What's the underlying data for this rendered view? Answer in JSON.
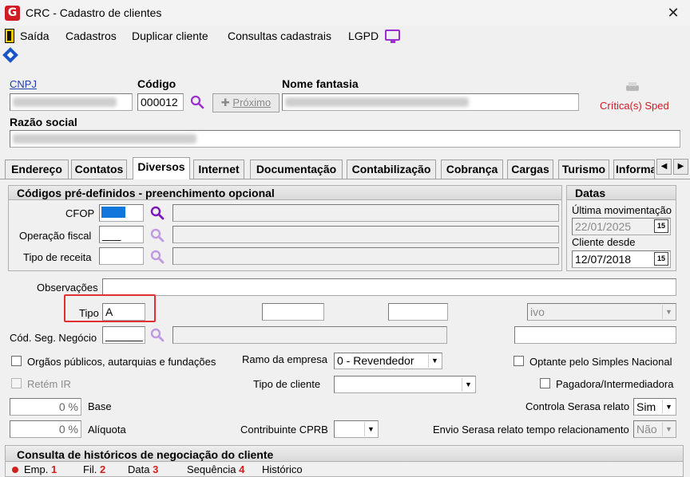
{
  "window": {
    "title": "CRC - Cadastro de clientes"
  },
  "menu": {
    "items": [
      "Saída",
      "Cadastros",
      "Duplicar cliente",
      "Consultas cadastrais",
      "LGPD"
    ]
  },
  "header": {
    "cnpj_label": "CNPJ",
    "codigo_label": "Código",
    "codigo_value": "000012",
    "proximo_label": "Próximo",
    "nome_fantasia_label": "Nome fantasia",
    "criticas_label": "Crítica(s) Sped",
    "razao_social_label": "Razão social"
  },
  "tabs": [
    "Endereço",
    "Contatos",
    "Diversos",
    "Internet",
    "Documentação",
    "Contabilização",
    "Cobrança",
    "Cargas",
    "Turismo",
    "Informa"
  ],
  "active_tab": "Diversos",
  "codigos": {
    "title": "Códigos pré-definidos - preenchimento opcional",
    "cfop_label": "CFOP",
    "operacao_label": "Operação fiscal",
    "operacao_value": "___",
    "tipo_receita_label": "Tipo de receita"
  },
  "datas": {
    "title": "Datas",
    "ultima_label": "Última movimentação",
    "ultima_value": "22/01/2025",
    "cliente_desde_label": "Cliente desde",
    "cliente_desde_value": "12/07/2018",
    "cal_text": "15"
  },
  "diversos": {
    "observacoes_label": "Observações",
    "tipo_label": "Tipo",
    "tipo_value": "A",
    "status_value": "ivo",
    "cod_seg_label": "Cód. Seg. Negócio",
    "cod_seg_value": "______",
    "orgaos_label": "Orgãos públicos, autarquias e fundações",
    "ramo_label": "Ramo da empresa",
    "ramo_value": "0 - Revendedor",
    "optante_label": "Optante pelo Simples Nacional",
    "retem_label": "Retém IR",
    "tipo_cliente_label": "Tipo de cliente",
    "pagadora_label": "Pagadora/Intermediadora",
    "base_label": "Base",
    "base_value": "0 %",
    "controla_label": "Controla Serasa relato",
    "controla_value": "Sim",
    "aliquota_label": "Alíquota",
    "aliquota_value": "0 %",
    "contribuinte_label": "Contribuinte CPRB",
    "envio_label": "Envio Serasa relato tempo relacionamento",
    "envio_value": "Não"
  },
  "historico": {
    "title": "Consulta de históricos de negociação do cliente",
    "columns": [
      "Emp.",
      "Fil.",
      "Data",
      "Sequência",
      "Histórico"
    ],
    "sort_marks": [
      "1",
      "2",
      "3",
      "4"
    ]
  },
  "colors": {
    "accent": "#1f3fb0",
    "warning": "#d01c24",
    "highlight": "#e03030",
    "icon": "#9b2fd0"
  }
}
